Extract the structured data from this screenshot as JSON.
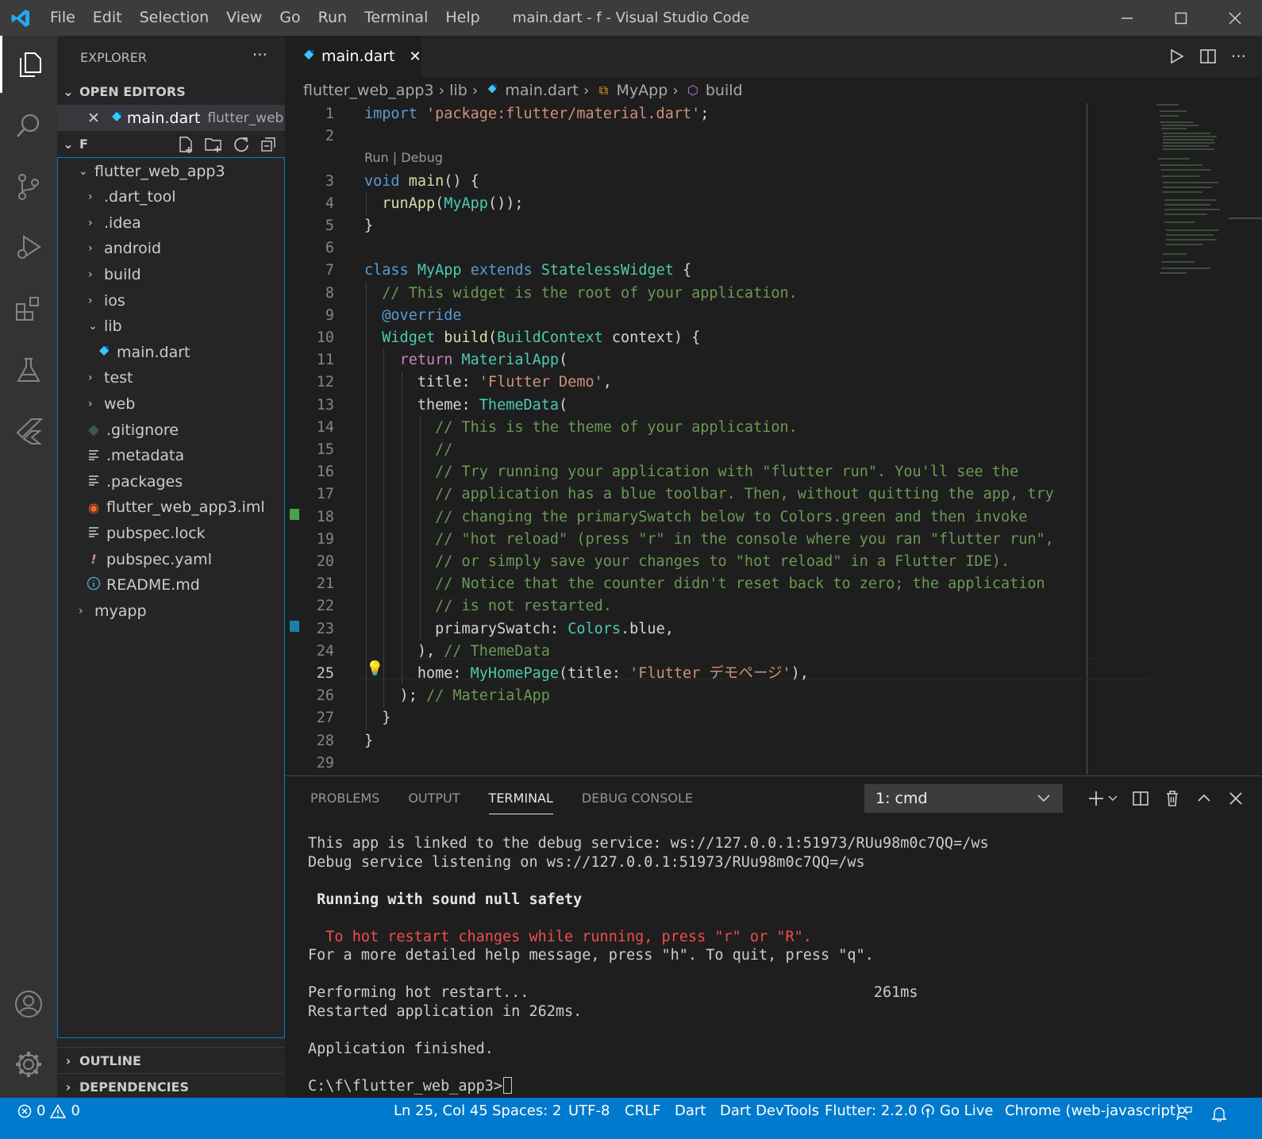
{
  "window": {
    "title": "main.dart - f - Visual Studio Code"
  },
  "menu": [
    "File",
    "Edit",
    "Selection",
    "View",
    "Go",
    "Run",
    "Terminal",
    "Help"
  ],
  "sidebar": {
    "title": "EXPLORER",
    "open_editors": {
      "label": "OPEN EDITORS",
      "file": "main.dart",
      "folder": "flutter_web..."
    },
    "workspace": {
      "label": "F"
    },
    "tree": [
      {
        "label": "flutter_web_app3",
        "icon": "chevron-down"
      },
      {
        "label": ".dart_tool",
        "icon": "chevron-right"
      },
      {
        "label": ".idea",
        "icon": "chevron-right"
      },
      {
        "label": "android",
        "icon": "chevron-right"
      },
      {
        "label": "build",
        "icon": "chevron-right"
      },
      {
        "label": "ios",
        "icon": "chevron-right"
      },
      {
        "label": "lib",
        "icon": "chevron-down"
      },
      {
        "label": "main.dart",
        "icon": "dart-file-icon"
      },
      {
        "label": "test",
        "icon": "chevron-right"
      },
      {
        "label": "web",
        "icon": "chevron-right"
      },
      {
        "label": ".gitignore",
        "icon": "git-file-icon"
      },
      {
        "label": ".metadata",
        "icon": "text-file-icon"
      },
      {
        "label": ".packages",
        "icon": "text-file-icon"
      },
      {
        "label": "flutter_web_app3.iml",
        "icon": "rss-file-icon"
      },
      {
        "label": "pubspec.lock",
        "icon": "text-file-icon"
      },
      {
        "label": "pubspec.yaml",
        "icon": "yaml-file-icon"
      },
      {
        "label": "README.md",
        "icon": "info-file-icon"
      },
      {
        "label": "myapp",
        "icon": "chevron-right"
      }
    ],
    "outline": "OUTLINE",
    "dependencies": "DEPENDENCIES"
  },
  "editor": {
    "tab": "main.dart",
    "breadcrumb": [
      "flutter_web_app3",
      "lib",
      "main.dart",
      "MyApp",
      "build"
    ],
    "codelens": "Run | Debug",
    "line_numbers": [
      "1",
      "2",
      "3",
      "4",
      "5",
      "6",
      "7",
      "8",
      "9",
      "10",
      "11",
      "12",
      "13",
      "14",
      "15",
      "16",
      "17",
      "18",
      "19",
      "20",
      "21",
      "22",
      "23",
      "24",
      "25",
      "26",
      "27",
      "28",
      "29"
    ],
    "lines": [
      [
        [
          "k",
          "import"
        ],
        [
          "w",
          " "
        ],
        [
          "s",
          "'package:flutter/material.dart'"
        ],
        [
          "w",
          ";"
        ]
      ],
      [],
      [
        [
          "k",
          "void"
        ],
        [
          "w",
          " "
        ],
        [
          "f",
          "main"
        ],
        [
          "w",
          "() {"
        ]
      ],
      [
        [
          "w",
          "  "
        ],
        [
          "f",
          "runApp"
        ],
        [
          "w",
          "("
        ],
        [
          "t",
          "MyApp"
        ],
        [
          "w",
          "());"
        ]
      ],
      [
        [
          "w",
          "}"
        ]
      ],
      [],
      [
        [
          "k",
          "class"
        ],
        [
          "w",
          " "
        ],
        [
          "t",
          "MyApp"
        ],
        [
          "w",
          " "
        ],
        [
          "k",
          "extends"
        ],
        [
          "w",
          " "
        ],
        [
          "t",
          "StatelessWidget"
        ],
        [
          "w",
          " {"
        ]
      ],
      [
        [
          "w",
          "  "
        ],
        [
          "c",
          "// This widget is the root of your application."
        ]
      ],
      [
        [
          "w",
          "  "
        ],
        [
          "k",
          "@override"
        ]
      ],
      [
        [
          "w",
          "  "
        ],
        [
          "t",
          "Widget"
        ],
        [
          "w",
          " "
        ],
        [
          "f",
          "build"
        ],
        [
          "w",
          "("
        ],
        [
          "t",
          "BuildContext"
        ],
        [
          "w",
          " context) {"
        ]
      ],
      [
        [
          "w",
          "    "
        ],
        [
          "kw",
          "return"
        ],
        [
          "w",
          " "
        ],
        [
          "t",
          "MaterialApp"
        ],
        [
          "w",
          "("
        ]
      ],
      [
        [
          "w",
          "      title: "
        ],
        [
          "s",
          "'Flutter Demo'"
        ],
        [
          "w",
          ","
        ]
      ],
      [
        [
          "w",
          "      theme: "
        ],
        [
          "t",
          "ThemeData"
        ],
        [
          "w",
          "("
        ]
      ],
      [
        [
          "w",
          "        "
        ],
        [
          "c",
          "// This is the theme of your application."
        ]
      ],
      [
        [
          "w",
          "        "
        ],
        [
          "c",
          "//"
        ]
      ],
      [
        [
          "w",
          "        "
        ],
        [
          "c",
          "// Try running your application with \"flutter run\". You'll see the"
        ]
      ],
      [
        [
          "w",
          "        "
        ],
        [
          "c",
          "// application has a blue toolbar. Then, without quitting the app, try"
        ]
      ],
      [
        [
          "w",
          "        "
        ],
        [
          "c",
          "// changing the primarySwatch below to Colors.green and then invoke"
        ]
      ],
      [
        [
          "w",
          "        "
        ],
        [
          "c",
          "// \"hot reload\" (press \"r\" in the console where you ran \"flutter run\","
        ]
      ],
      [
        [
          "w",
          "        "
        ],
        [
          "c",
          "// or simply save your changes to \"hot reload\" in a Flutter IDE)."
        ]
      ],
      [
        [
          "w",
          "        "
        ],
        [
          "c",
          "// Notice that the counter didn't reset back to zero; the application"
        ]
      ],
      [
        [
          "w",
          "        "
        ],
        [
          "c",
          "// is not restarted."
        ]
      ],
      [
        [
          "w",
          "        primarySwatch: "
        ],
        [
          "t",
          "Colors"
        ],
        [
          "w",
          ".blue,"
        ]
      ],
      [
        [
          "w",
          "      ), "
        ],
        [
          "c",
          "// ThemeData"
        ]
      ],
      [
        [
          "w",
          "      home: "
        ],
        [
          "t",
          "MyHomePage"
        ],
        [
          "w",
          "(title: "
        ],
        [
          "s",
          "'Flutter デモページ'"
        ],
        [
          "w",
          "),"
        ]
      ],
      [
        [
          "w",
          "    ); "
        ],
        [
          "c",
          "// MaterialApp"
        ]
      ],
      [
        [
          "w",
          "  }"
        ]
      ],
      [
        [
          "w",
          "}"
        ]
      ],
      []
    ]
  },
  "panel": {
    "tabs": [
      "PROBLEMS",
      "OUTPUT",
      "TERMINAL",
      "DEBUG CONSOLE"
    ],
    "terminal_select": "1: cmd",
    "terminal_lines": [
      {
        "text": "This app is linked to the debug service: ws://127.0.0.1:51973/RUu98m0c7QQ=/ws",
        "style": "normal"
      },
      {
        "text": "Debug service listening on ws://127.0.0.1:51973/RUu98m0c7QQ=/ws",
        "style": "normal"
      },
      {
        "text": "",
        "style": "normal"
      },
      {
        "text": " Running with sound null safety",
        "style": "bold"
      },
      {
        "text": "",
        "style": "normal"
      },
      {
        "text": "  To hot restart changes while running, press \"r\" or \"R\".",
        "style": "red"
      },
      {
        "text": "For a more detailed help message, press \"h\". To quit, press \"q\".",
        "style": "normal"
      },
      {
        "text": "",
        "style": "normal"
      },
      {
        "text": "Performing hot restart...                                       261ms",
        "style": "normal"
      },
      {
        "text": "Restarted application in 262ms.",
        "style": "normal"
      },
      {
        "text": "",
        "style": "normal"
      },
      {
        "text": "Application finished.",
        "style": "normal"
      },
      {
        "text": "",
        "style": "normal"
      },
      {
        "text": "C:\\f\\flutter_web_app3>",
        "style": "prompt"
      }
    ]
  },
  "status": {
    "errors": "0",
    "warnings": "0",
    "position": "Ln 25, Col 45",
    "spaces": "Spaces: 2",
    "encoding": "UTF-8",
    "eol": "CRLF",
    "language": "Dart",
    "devtools": "Dart DevTools",
    "flutter": "Flutter: 2.2.0",
    "golive": "Go Live",
    "device": "Chrome (web-javascript)"
  },
  "colors": {
    "accent": "#007acc",
    "titlebar": "#3c3c3c",
    "activity": "#333333",
    "sidebar": "#252526",
    "editor": "#1e1e1e"
  }
}
